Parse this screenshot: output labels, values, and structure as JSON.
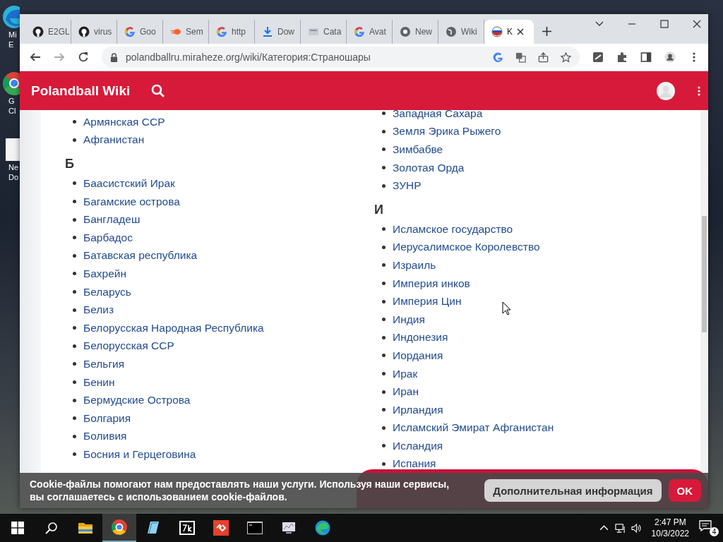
{
  "desktop": {
    "icons": [
      {
        "kind": "edge",
        "lines": [
          "Mi",
          "E"
        ]
      },
      {
        "kind": "chrome",
        "lines": [
          "G",
          "Cl"
        ]
      },
      {
        "kind": "document",
        "lines": [
          "Ne",
          "Do"
        ]
      }
    ]
  },
  "browser": {
    "tabs": [
      {
        "kind": "github",
        "label": "E2GL",
        "selected": false
      },
      {
        "kind": "github",
        "label": "virus",
        "selected": false
      },
      {
        "kind": "google",
        "label": "Goo",
        "selected": false
      },
      {
        "kind": "semrush",
        "label": "Sem",
        "selected": false
      },
      {
        "kind": "google",
        "label": "http",
        "selected": false
      },
      {
        "kind": "download",
        "label": "Dow",
        "selected": false
      },
      {
        "kind": "catalog",
        "label": "Cata",
        "selected": false
      },
      {
        "kind": "google",
        "label": "Avat",
        "selected": false
      },
      {
        "kind": "chrome",
        "label": "New",
        "selected": false
      },
      {
        "kind": "globe",
        "label": "Wiki",
        "selected": false
      },
      {
        "kind": "ball",
        "label": "K",
        "selected": true
      }
    ],
    "address": "polandballru.miraheze.org/wiki/Категория:Страношары"
  },
  "site": {
    "title": "Polandball Wiki"
  },
  "columns": [
    {
      "sections": [
        {
          "items": [
            "Армянская ССР",
            "Афганистан"
          ]
        },
        {
          "heading": "Б",
          "items": [
            "Баасистский Ирак",
            "Багамские острова",
            "Бангладеш",
            "Барбадос",
            "Батавская республика",
            "Бахрейн",
            "Беларусь",
            "Белиз",
            "Белорусская Народная Республика",
            "Белорусская ССР",
            "Бельгия",
            "Бенин",
            "Бермудские Острова",
            "Болгария",
            "Боливия",
            "Босния и Герцеговина"
          ]
        }
      ]
    },
    {
      "sections": [
        {
          "items": [
            "Западная Сахара",
            "Земля Эрика Рыжего",
            "Зимбабве",
            "Золотая Орда",
            "ЗУНР"
          ]
        },
        {
          "heading": "И",
          "items": [
            "Исламское государство",
            "Иерусалимское Королевство",
            "Израиль",
            "Империя инков",
            "Империя Цин",
            "Индия",
            "Индонезия",
            "Иордания",
            "Ирак",
            "Иран",
            "Ирландия",
            "Исламский Эмират Афганистан",
            "Исландия",
            "Испания"
          ]
        }
      ]
    }
  ],
  "cookie_banner": {
    "text": "Cookie-файлы помогают нам предоставлять наши услуги. Используя наши сервисы, вы соглашаетесь с использованием cookie-файлов.",
    "buttons": [
      {
        "kind": "secondary",
        "label": "Дополнительная информация"
      },
      {
        "kind": "primary",
        "label": "OK"
      }
    ]
  },
  "taskbar": {
    "apps": [
      {
        "kind": "explorer",
        "selected": false
      },
      {
        "kind": "chrome",
        "selected": true
      },
      {
        "kind": "notepad",
        "selected": false
      },
      {
        "kind": "archiver",
        "selected": false
      },
      {
        "kind": "remote",
        "selected": false
      },
      {
        "kind": "terminal",
        "selected": false
      },
      {
        "kind": "monitor",
        "selected": false
      },
      {
        "kind": "edge",
        "selected": false
      }
    ],
    "time": "2:47 PM",
    "date": "10/3/2022",
    "notifications": "4"
  }
}
